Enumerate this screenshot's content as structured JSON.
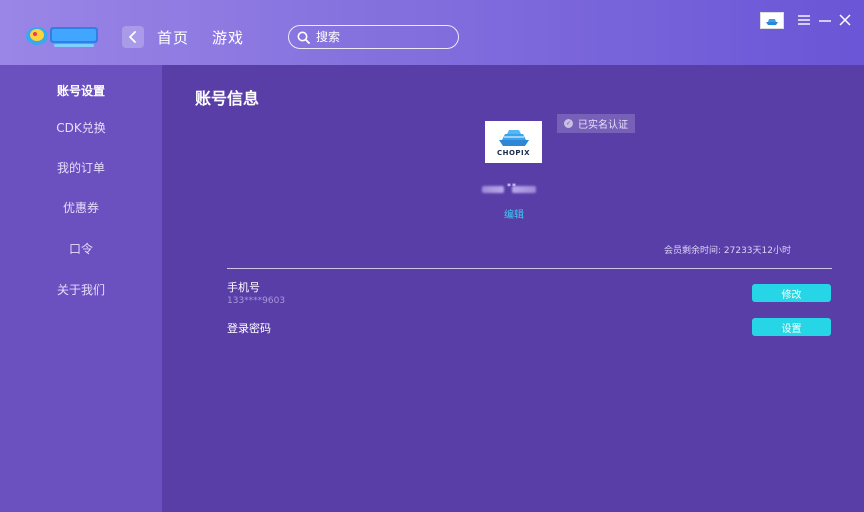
{
  "header": {
    "nav_home": "首页",
    "nav_game": "游戏",
    "search_placeholder": "搜索"
  },
  "sidebar": {
    "items": [
      {
        "label": "账号设置",
        "active": true
      },
      {
        "label": "CDK兑换"
      },
      {
        "label": "我的订单"
      },
      {
        "label": "优惠券"
      },
      {
        "label": "口令"
      },
      {
        "label": "关于我们"
      }
    ]
  },
  "main": {
    "title": "账号信息",
    "avatar_text": "CHOPIX",
    "verify_badge": "已实名认证",
    "username_masked": "**",
    "edit_label": "编辑",
    "member_time": "会员剩余时间: 27233天12小时",
    "phone": {
      "label": "手机号",
      "value": "133****9603",
      "button": "修改"
    },
    "password": {
      "label": "登录密码",
      "button": "设置"
    }
  },
  "colors": {
    "accent_button": "#26d6e6",
    "edit_link": "#3ec8f0",
    "sidebar_bg": "#6b50c0",
    "main_bg": "#5a3ea8"
  }
}
